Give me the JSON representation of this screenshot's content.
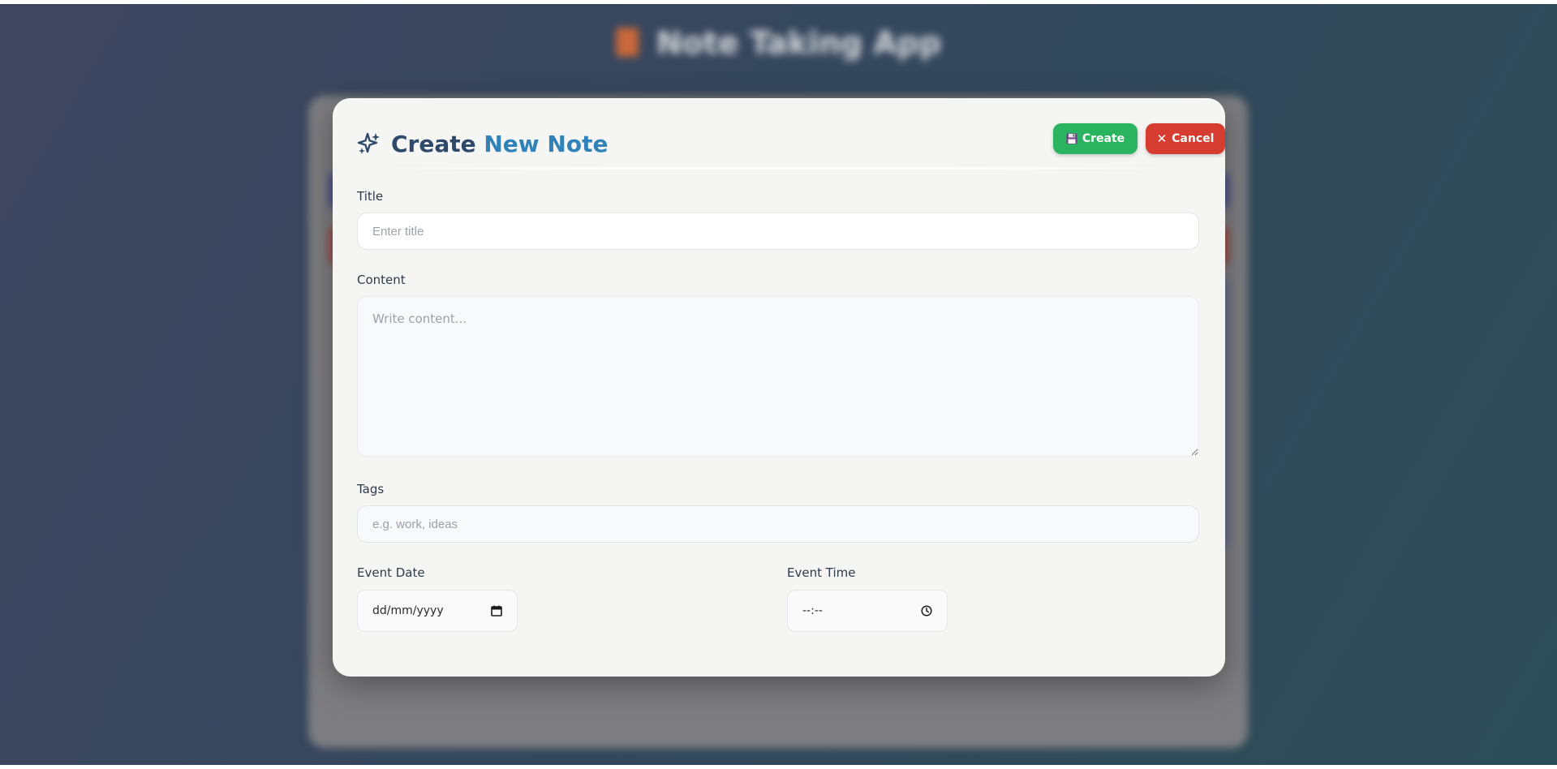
{
  "background": {
    "app_title": "Note Taking App"
  },
  "modal": {
    "title_part1": "Create",
    "title_part2": "New Note",
    "create_label": "Create",
    "cancel_label": "Cancel"
  },
  "form": {
    "title": {
      "label": "Title",
      "placeholder": "Enter title",
      "value": ""
    },
    "content": {
      "label": "Content",
      "placeholder": "Write content...",
      "value": ""
    },
    "tags": {
      "label": "Tags",
      "placeholder": "e.g. work, ideas",
      "value": ""
    },
    "event_date": {
      "label": "Event Date",
      "display": "dd/mm/yyyy"
    },
    "event_time": {
      "label": "Event Time",
      "display": "--:--"
    }
  },
  "colors": {
    "create_button": "#2bb45f",
    "cancel_button": "#d63c2f",
    "title_dark": "#2e4a6b",
    "title_accent": "#3182b8"
  },
  "icons": {
    "header": "sparkle-icon",
    "create": "floppy-disk-icon",
    "cancel": "close-icon",
    "date": "calendar-icon",
    "time": "clock-icon"
  }
}
